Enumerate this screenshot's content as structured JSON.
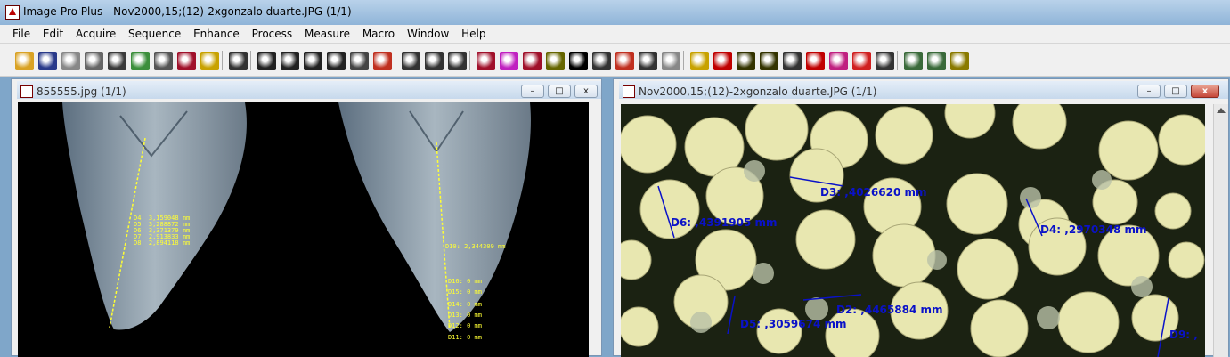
{
  "app": {
    "title": "Image-Pro Plus - Nov2000,15;(12)-2xgonzalo duarte.JPG (1/1)"
  },
  "menu": [
    "File",
    "Edit",
    "Acquire",
    "Sequence",
    "Enhance",
    "Process",
    "Measure",
    "Macro",
    "Window",
    "Help"
  ],
  "toolbar": {
    "groups": [
      [
        {
          "icon": "open-folder-icon",
          "color": "#d9a224"
        },
        {
          "icon": "save-icon",
          "color": "#2a3a8a"
        },
        {
          "icon": "grid-icon",
          "color": "#888888"
        },
        {
          "icon": "video-capture-icon",
          "color": "#666666"
        },
        {
          "icon": "lasso-icon",
          "color": "#3a3a3a"
        },
        {
          "icon": "copy-icon",
          "color": "#3c8f3c"
        },
        {
          "icon": "print-icon",
          "color": "#555555"
        },
        {
          "icon": "book-icon",
          "color": "#a0102a"
        },
        {
          "icon": "mail-icon",
          "color": "#c8a200"
        }
      ],
      [
        {
          "icon": "undo-icon",
          "color": "#333333"
        }
      ],
      [
        {
          "icon": "new-aoi-icon",
          "color": "#222222"
        },
        {
          "icon": "rectangle-icon",
          "color": "#222222"
        },
        {
          "icon": "ellipse-icon",
          "color": "#222222"
        },
        {
          "icon": "freehand-icon",
          "color": "#222222"
        },
        {
          "icon": "magic-wand-icon",
          "color": "#444444"
        },
        {
          "icon": "pencil-icon",
          "color": "#c03020"
        }
      ],
      [
        {
          "icon": "magnifier-icon",
          "color": "#333333"
        },
        {
          "icon": "hand-icon",
          "color": "#333333"
        },
        {
          "icon": "zoom-select-icon",
          "color": "#333333"
        }
      ],
      [
        {
          "icon": "contrast-icon",
          "color": "#a0102a"
        },
        {
          "icon": "histogram-icon",
          "color": "#c020c0"
        },
        {
          "icon": "levels-icon",
          "color": "#a0102a"
        },
        {
          "icon": "layers-icon",
          "color": "#666600"
        },
        {
          "icon": "threshold-icon",
          "color": "#000000"
        },
        {
          "icon": "dots-grid-icon",
          "color": "#333333"
        },
        {
          "icon": "math-ops-icon",
          "color": "#c03020"
        },
        {
          "icon": "segment-icon",
          "color": "#333333"
        },
        {
          "icon": "stack-icon",
          "color": "#888888"
        }
      ],
      [
        {
          "icon": "ruler-icon",
          "color": "#c8a200"
        },
        {
          "icon": "count-icon",
          "color": "#c00000"
        },
        {
          "icon": "caliper-icon",
          "color": "#333300"
        },
        {
          "icon": "measure-icon",
          "color": "#333300"
        },
        {
          "icon": "camera-icon",
          "color": "#333333"
        },
        {
          "icon": "line-profile-icon",
          "color": "#c00000"
        },
        {
          "icon": "surface-plot-icon",
          "color": "#c02080"
        },
        {
          "icon": "cube-icon",
          "color": "#d02020"
        },
        {
          "icon": "data-sheet-icon",
          "color": "#333333"
        }
      ],
      [
        {
          "icon": "macro-record-icon",
          "color": "#3a6a3a"
        },
        {
          "icon": "macro-run-icon",
          "color": "#3a6a3a"
        },
        {
          "icon": "macro-edit-icon",
          "color": "#8a7a00"
        }
      ]
    ]
  },
  "left_window": {
    "title": "855555.jpg (1/1)",
    "labels_left": [
      "D4: 3,159048 mm",
      "D5: 3,288872 mm",
      "D6: 3,371379 mm",
      "D7: 2,913833 mm",
      "D8: 2,894118 mm"
    ],
    "labels_right": [
      "D10: 2,344309 mm",
      "D16: 0 mm",
      "D15: 0 mm",
      "D14: 0 mm",
      "D13: 0 mm",
      "D12: 0 mm",
      "D11: 0 mm"
    ]
  },
  "right_window": {
    "title": "Nov2000,15;(12)-2xgonzalo duarte.JPG (1/1)",
    "measurements": [
      {
        "label": "D6:  ,4391905 mm"
      },
      {
        "label": "D3:  ,4026620 mm"
      },
      {
        "label": "D4:  ,2970348 mm"
      },
      {
        "label": "D2:  ,4465884 mm"
      },
      {
        "label": "D5:  ,3059674 mm"
      },
      {
        "label": "D9:  ,"
      }
    ]
  },
  "window_controls": {
    "minimize": "–",
    "maximize": "□",
    "close": "x"
  },
  "colors": {
    "measure_blue": "#0a12c8",
    "measure_yellow": "#ffff33",
    "egg": "#e8e7b0",
    "bg_dark": "#1b2212"
  }
}
